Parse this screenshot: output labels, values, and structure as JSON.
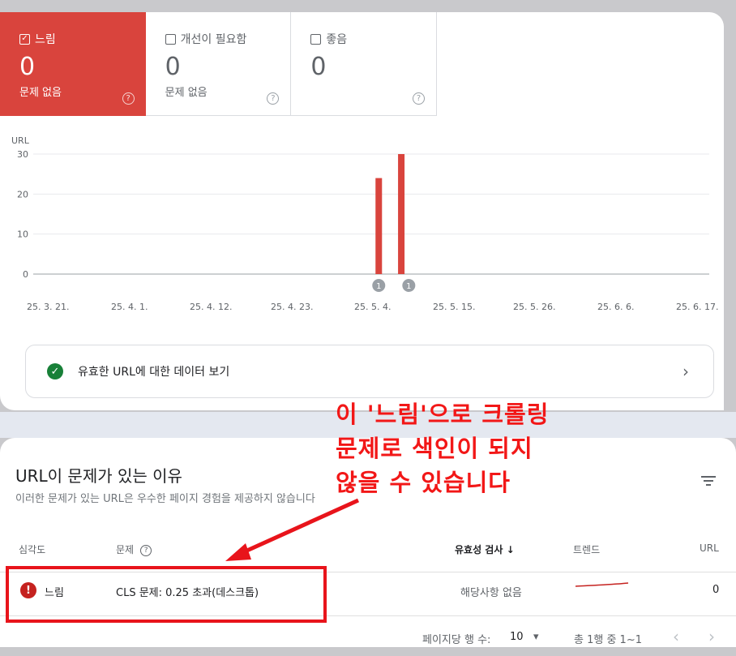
{
  "tiles": [
    {
      "label": "느림",
      "value": "0",
      "sub": "문제 없음",
      "checked": true
    },
    {
      "label": "개선이 필요함",
      "value": "0",
      "sub": "문제 없음",
      "checked": false
    },
    {
      "label": "좋음",
      "value": "0",
      "sub": "",
      "checked": false
    }
  ],
  "icons": {
    "checkbox": "checkbox-icon",
    "help": "help-circle-icon",
    "check": "check-circle-icon",
    "chevron": "chevron-right-icon",
    "filter": "filter-icon",
    "error": "error-icon",
    "sort": "arrow-down-icon"
  },
  "colors": {
    "slow": "#d9443d",
    "valid": "#188038",
    "error": "#c5221f",
    "annotation": "#f21717"
  },
  "chart_data": {
    "type": "bar",
    "ylabel": "URL",
    "ylim": [
      0,
      30
    ],
    "yticks": [
      "0",
      "10",
      "20",
      "30"
    ],
    "xticks": [
      "25. 3. 21.",
      "25. 4. 1.",
      "25. 4. 12.",
      "25. 4. 23.",
      "25. 5. 4.",
      "25. 5. 15.",
      "25. 5. 26.",
      "25. 6. 6.",
      "25. 6. 17."
    ],
    "x_range": [
      "2025-03-21",
      "2025-06-19"
    ],
    "bars": [
      {
        "date": "2025-05-06",
        "value": 24
      },
      {
        "date": "2025-05-09",
        "value": 30
      }
    ],
    "annotations": [
      {
        "date": "2025-05-06",
        "label": "1"
      },
      {
        "date": "2025-05-10",
        "label": "1"
      }
    ],
    "bar_color": "#d9443d",
    "grid": true
  },
  "valid_link": {
    "label": "유효한 URL에 대한 데이터 보기"
  },
  "section": {
    "title": "URL이 문제가 있는 이유",
    "subtitle": "이러한 문제가 있는 URL은 우수한 페이지 경험을 제공하지 않습니다"
  },
  "table": {
    "headers": {
      "severity": "심각도",
      "issue": "문제",
      "validation": "유효성 검사",
      "trend": "트렌드",
      "url": "URL"
    },
    "row": {
      "severity": "느림",
      "issue": "CLS 문제: 0.25 초과(데스크톱)",
      "validation": "해당사항 없음",
      "url": "0"
    }
  },
  "pager": {
    "rows_label": "페이지당 행 수:",
    "rows_value": "10",
    "range": "총 1행 중 1~1"
  },
  "annotation": {
    "line1": "이 '느림'으로 크롤링",
    "line2": "문제로 색인이 되지",
    "line3": "않을 수 있습니다"
  }
}
